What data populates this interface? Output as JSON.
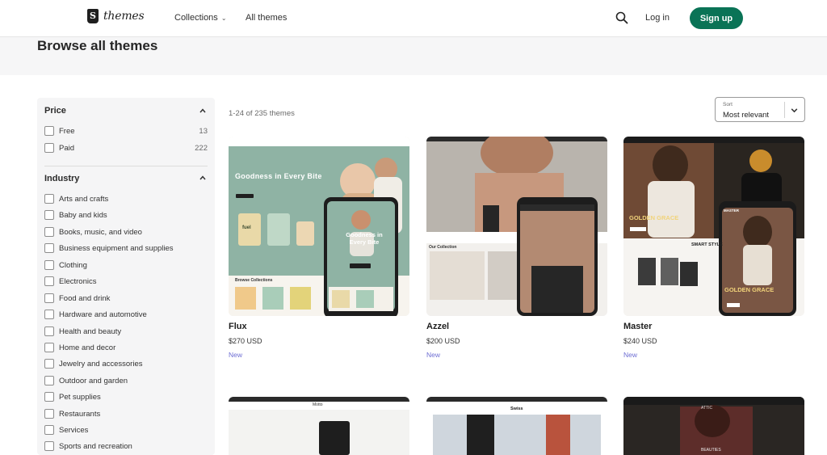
{
  "header": {
    "logo_text": "themes",
    "nav": {
      "collections": "Collections",
      "all_themes": "All themes"
    },
    "login": "Log in",
    "signup": "Sign up"
  },
  "page": {
    "title": "Browse all themes"
  },
  "filters": {
    "price": {
      "heading": "Price",
      "items": [
        {
          "label": "Free",
          "count": "13"
        },
        {
          "label": "Paid",
          "count": "222"
        }
      ]
    },
    "industry": {
      "heading": "Industry",
      "items": [
        {
          "label": "Arts and crafts"
        },
        {
          "label": "Baby and kids"
        },
        {
          "label": "Books, music, and video"
        },
        {
          "label": "Business equipment and supplies"
        },
        {
          "label": "Clothing"
        },
        {
          "label": "Electronics"
        },
        {
          "label": "Food and drink"
        },
        {
          "label": "Hardware and automotive"
        },
        {
          "label": "Health and beauty"
        },
        {
          "label": "Home and decor"
        },
        {
          "label": "Jewelry and accessories"
        },
        {
          "label": "Outdoor and garden"
        },
        {
          "label": "Pet supplies"
        },
        {
          "label": "Restaurants"
        },
        {
          "label": "Services"
        },
        {
          "label": "Sports and recreation"
        }
      ]
    }
  },
  "results": {
    "count_text": "1-24 of 235 themes",
    "sort": {
      "label": "Sort",
      "value": "Most relevant"
    },
    "themes": [
      {
        "name": "Flux",
        "price": "$270 USD",
        "badge": "New",
        "preview": {
          "headline": "Goodness in Every Bite",
          "mobile_headline": "Goodness in Every Bite",
          "section": "Browse Collections",
          "product_brand": "fuel"
        }
      },
      {
        "name": "Azzel",
        "price": "$200 USD",
        "badge": "New",
        "preview": {
          "section": "Our Collection"
        }
      },
      {
        "name": "Master",
        "price": "$240 USD",
        "badge": "New",
        "preview": {
          "headline": "GOLDEN GRACE",
          "subhead": "SMART STYLE",
          "mobile_headline": "GOLDEN GRACE",
          "mobile_brand": "MASTER"
        }
      }
    ],
    "second_row_previews": [
      {
        "brand": "Motto"
      },
      {
        "brand": "Swiss"
      },
      {
        "brand": "ATTIC",
        "caption": "BEAUTIES"
      }
    ]
  },
  "colors": {
    "accent": "#0a7356",
    "badge": "#6d6dd3",
    "sidebar_bg": "#f5f5f6",
    "hero_bg": "#f6f6f7"
  }
}
